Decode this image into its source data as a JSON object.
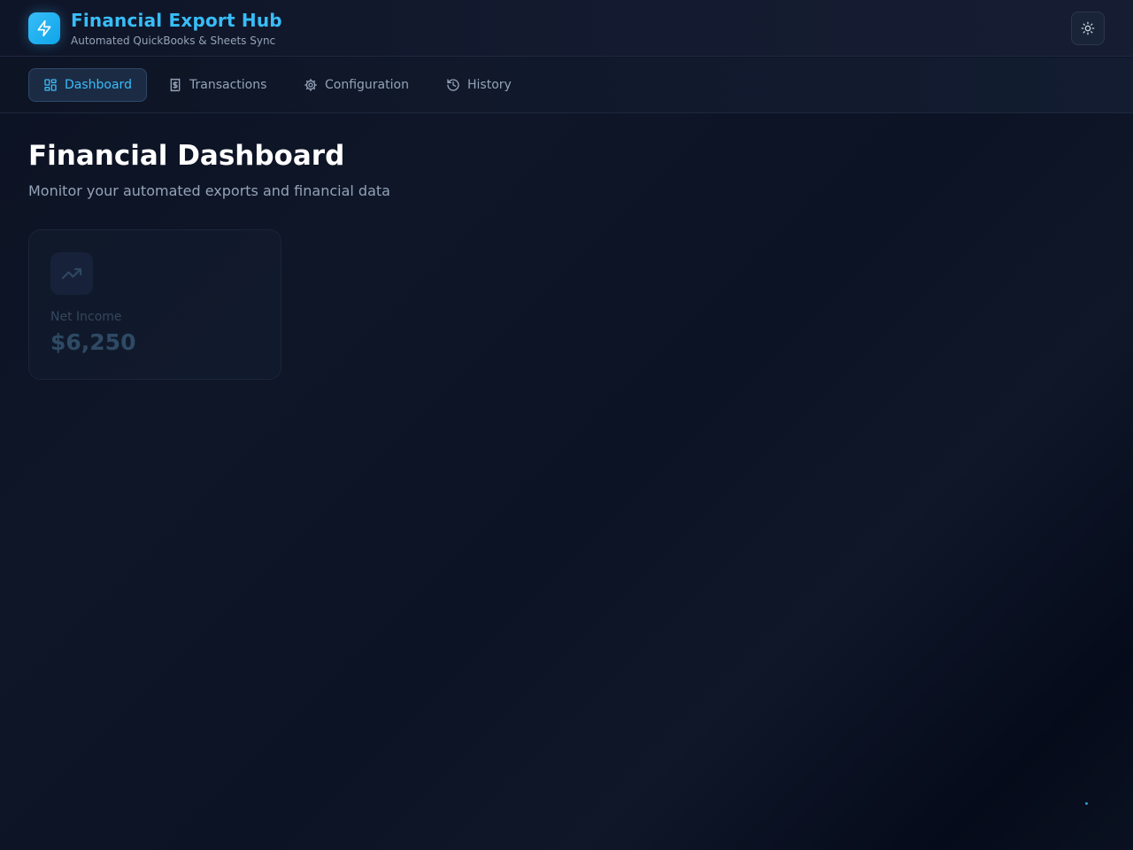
{
  "header": {
    "title": "Financial Export Hub",
    "subtitle": "Automated QuickBooks & Sheets Sync",
    "logo_icon": "lightning-icon",
    "theme_toggle_icon": "sun-icon"
  },
  "nav": {
    "items": [
      {
        "label": "Dashboard",
        "icon": "grid-icon",
        "active": true
      },
      {
        "label": "Transactions",
        "icon": "receipt-dollar-icon",
        "active": false
      },
      {
        "label": "Configuration",
        "icon": "gear-icon",
        "active": false
      },
      {
        "label": "History",
        "icon": "history-icon",
        "active": false
      }
    ]
  },
  "main": {
    "title": "Financial Dashboard",
    "subtitle": "Monitor your automated exports and financial data",
    "cards": [
      {
        "label": "Net Income",
        "value": "$6,250",
        "icon": "trending-up-icon"
      }
    ]
  },
  "colors": {
    "accent": "#38bdf8",
    "background": "#0c1222",
    "muted_text": "#94a3b8"
  }
}
